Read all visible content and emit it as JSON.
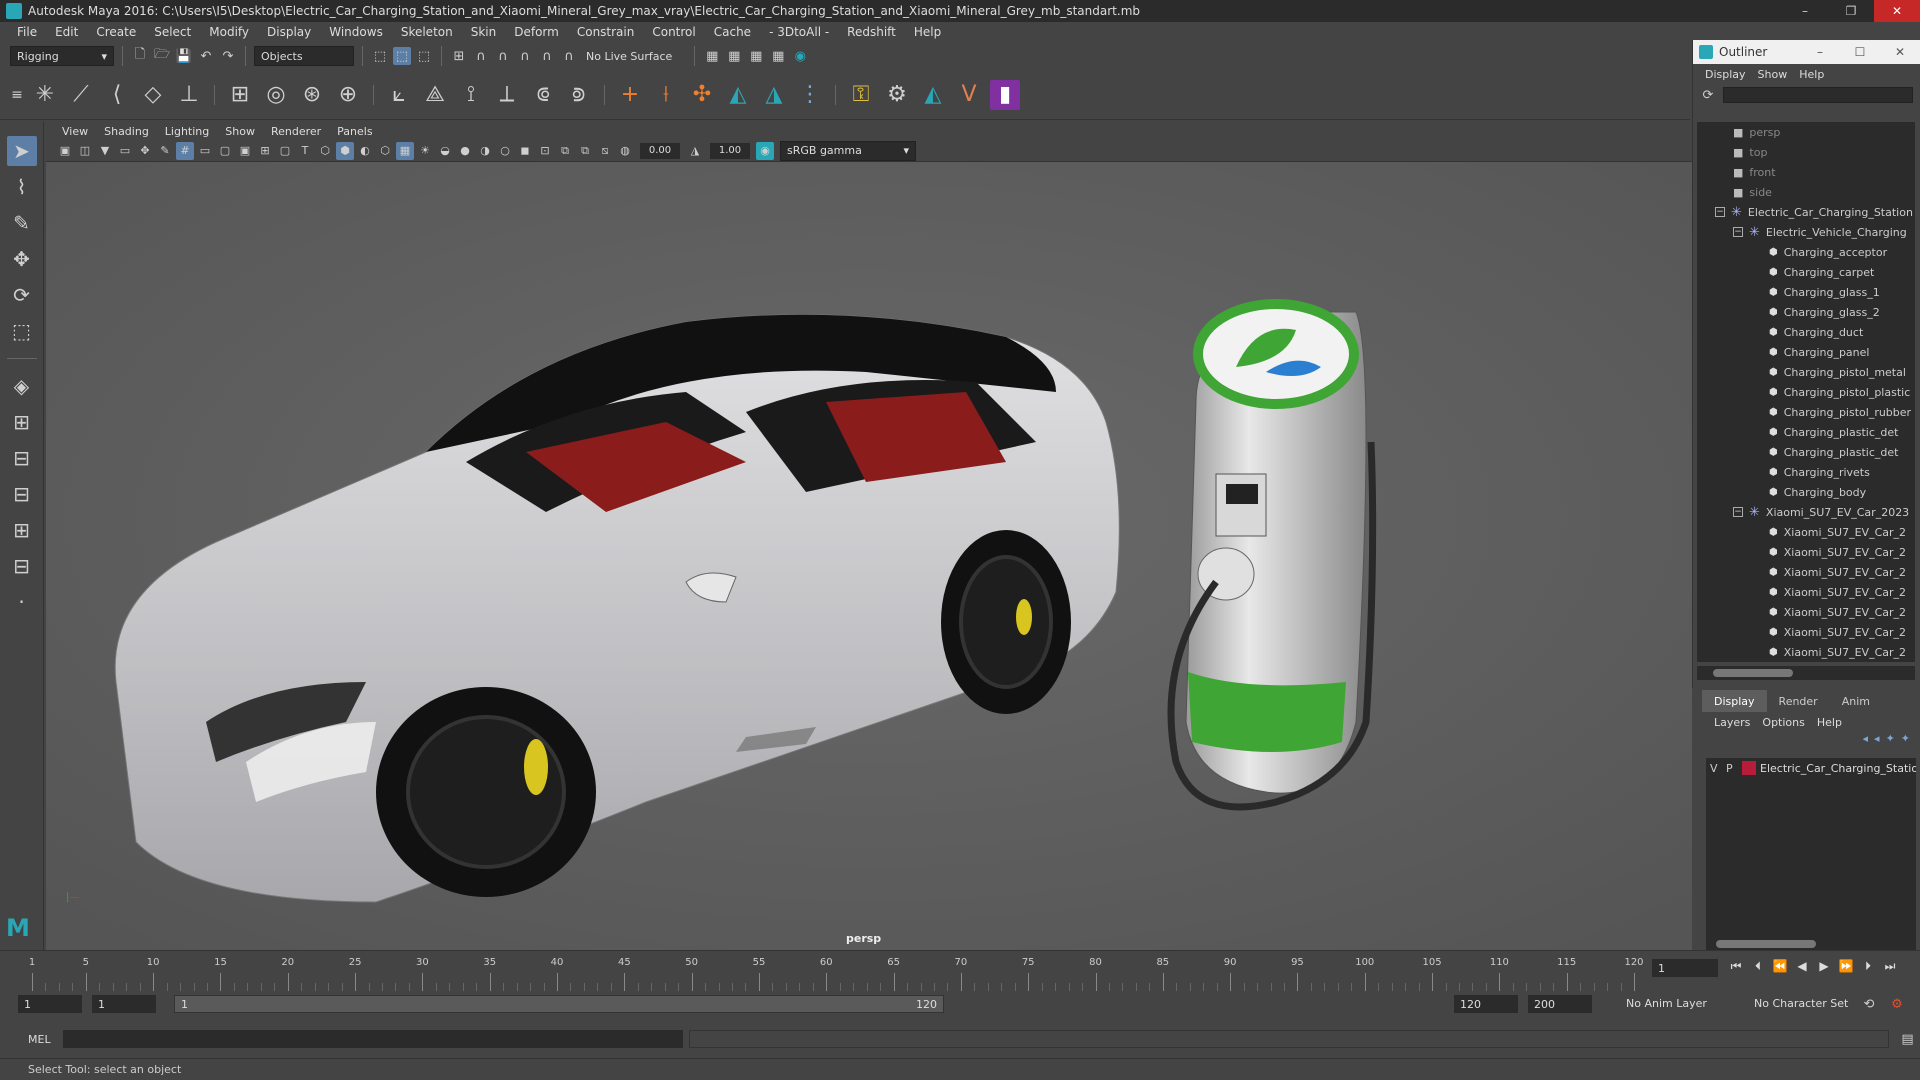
{
  "window": {
    "title": "Autodesk Maya 2016: C:\\Users\\I5\\Desktop\\Electric_Car_Charging_Station_and_Xiaomi_Mineral_Grey_max_vray\\Electric_Car_Charging_Station_and_Xiaomi_Mineral_Grey_mb_standart.mb",
    "minimize": "–",
    "maximize": "❐",
    "close": "✕"
  },
  "menu": [
    "File",
    "Edit",
    "Create",
    "Select",
    "Modify",
    "Display",
    "Windows",
    "Skeleton",
    "Skin",
    "Deform",
    "Constrain",
    "Control",
    "Cache",
    "- 3DtoAll -",
    "Redshift",
    "Help"
  ],
  "shelf": {
    "mode": "Rigging",
    "objects": "Objects",
    "live_surface": "No Live Surface"
  },
  "viewport": {
    "menu": [
      "View",
      "Shading",
      "Lighting",
      "Show",
      "Renderer",
      "Panels"
    ],
    "value1": "0.00",
    "value2": "1.00",
    "color_space": "sRGB gamma",
    "camera_label": "persp"
  },
  "outliner": {
    "title": "Outliner",
    "min": "–",
    "max": "☐",
    "close": "✕",
    "menu": [
      "Display",
      "Show",
      "Help"
    ],
    "cameras": [
      "persp",
      "top",
      "front",
      "side"
    ],
    "group1": "Electric_Car_Charging_Station",
    "group2": "Electric_Vehicle_Charging",
    "items_station": [
      "Charging_acceptor",
      "Charging_carpet",
      "Charging_glass_1",
      "Charging_glass_2",
      "Charging_duct",
      "Charging_panel",
      "Charging_pistol_metal",
      "Charging_pistol_plastic",
      "Charging_pistol_rubber",
      "Charging_plastic_det",
      "Charging_plastic_det",
      "Charging_rivets",
      "Charging_body"
    ],
    "group3": "Xiaomi_SU7_EV_Car_2023",
    "items_car": [
      "Xiaomi_SU7_EV_Car_2",
      "Xiaomi_SU7_EV_Car_2",
      "Xiaomi_SU7_EV_Car_2",
      "Xiaomi_SU7_EV_Car_2",
      "Xiaomi_SU7_EV_Car_2",
      "Xiaomi_SU7_EV_Car_2",
      "Xiaomi_SU7_EV_Car_2"
    ]
  },
  "layers": {
    "tabs": [
      "Display",
      "Render",
      "Anim"
    ],
    "menu": [
      "Layers",
      "Options",
      "Help"
    ],
    "layer_v": "V",
    "layer_p": "P",
    "layer_name": "Electric_Car_Charging_Station"
  },
  "timeline": {
    "labels": [
      "1",
      "5",
      "10",
      "15",
      "20",
      "25",
      "30",
      "35",
      "40",
      "45",
      "50",
      "55",
      "60",
      "65",
      "70",
      "75",
      "80",
      "85",
      "90",
      "95",
      "100",
      "105",
      "110",
      "115",
      "120"
    ],
    "current_frame": "1"
  },
  "range": {
    "start": "1",
    "start2": "1",
    "bar_start": "1",
    "bar_end": "120",
    "end": "120",
    "end2": "200",
    "anim_layer": "No Anim Layer",
    "char_set": "No Character Set"
  },
  "cmd": {
    "label": "MEL"
  },
  "status": {
    "text": "Select Tool: select an object"
  },
  "colors": {
    "accent": "#5d7fa6",
    "layer": "#b71c3a",
    "station_green": "#3fa535"
  }
}
